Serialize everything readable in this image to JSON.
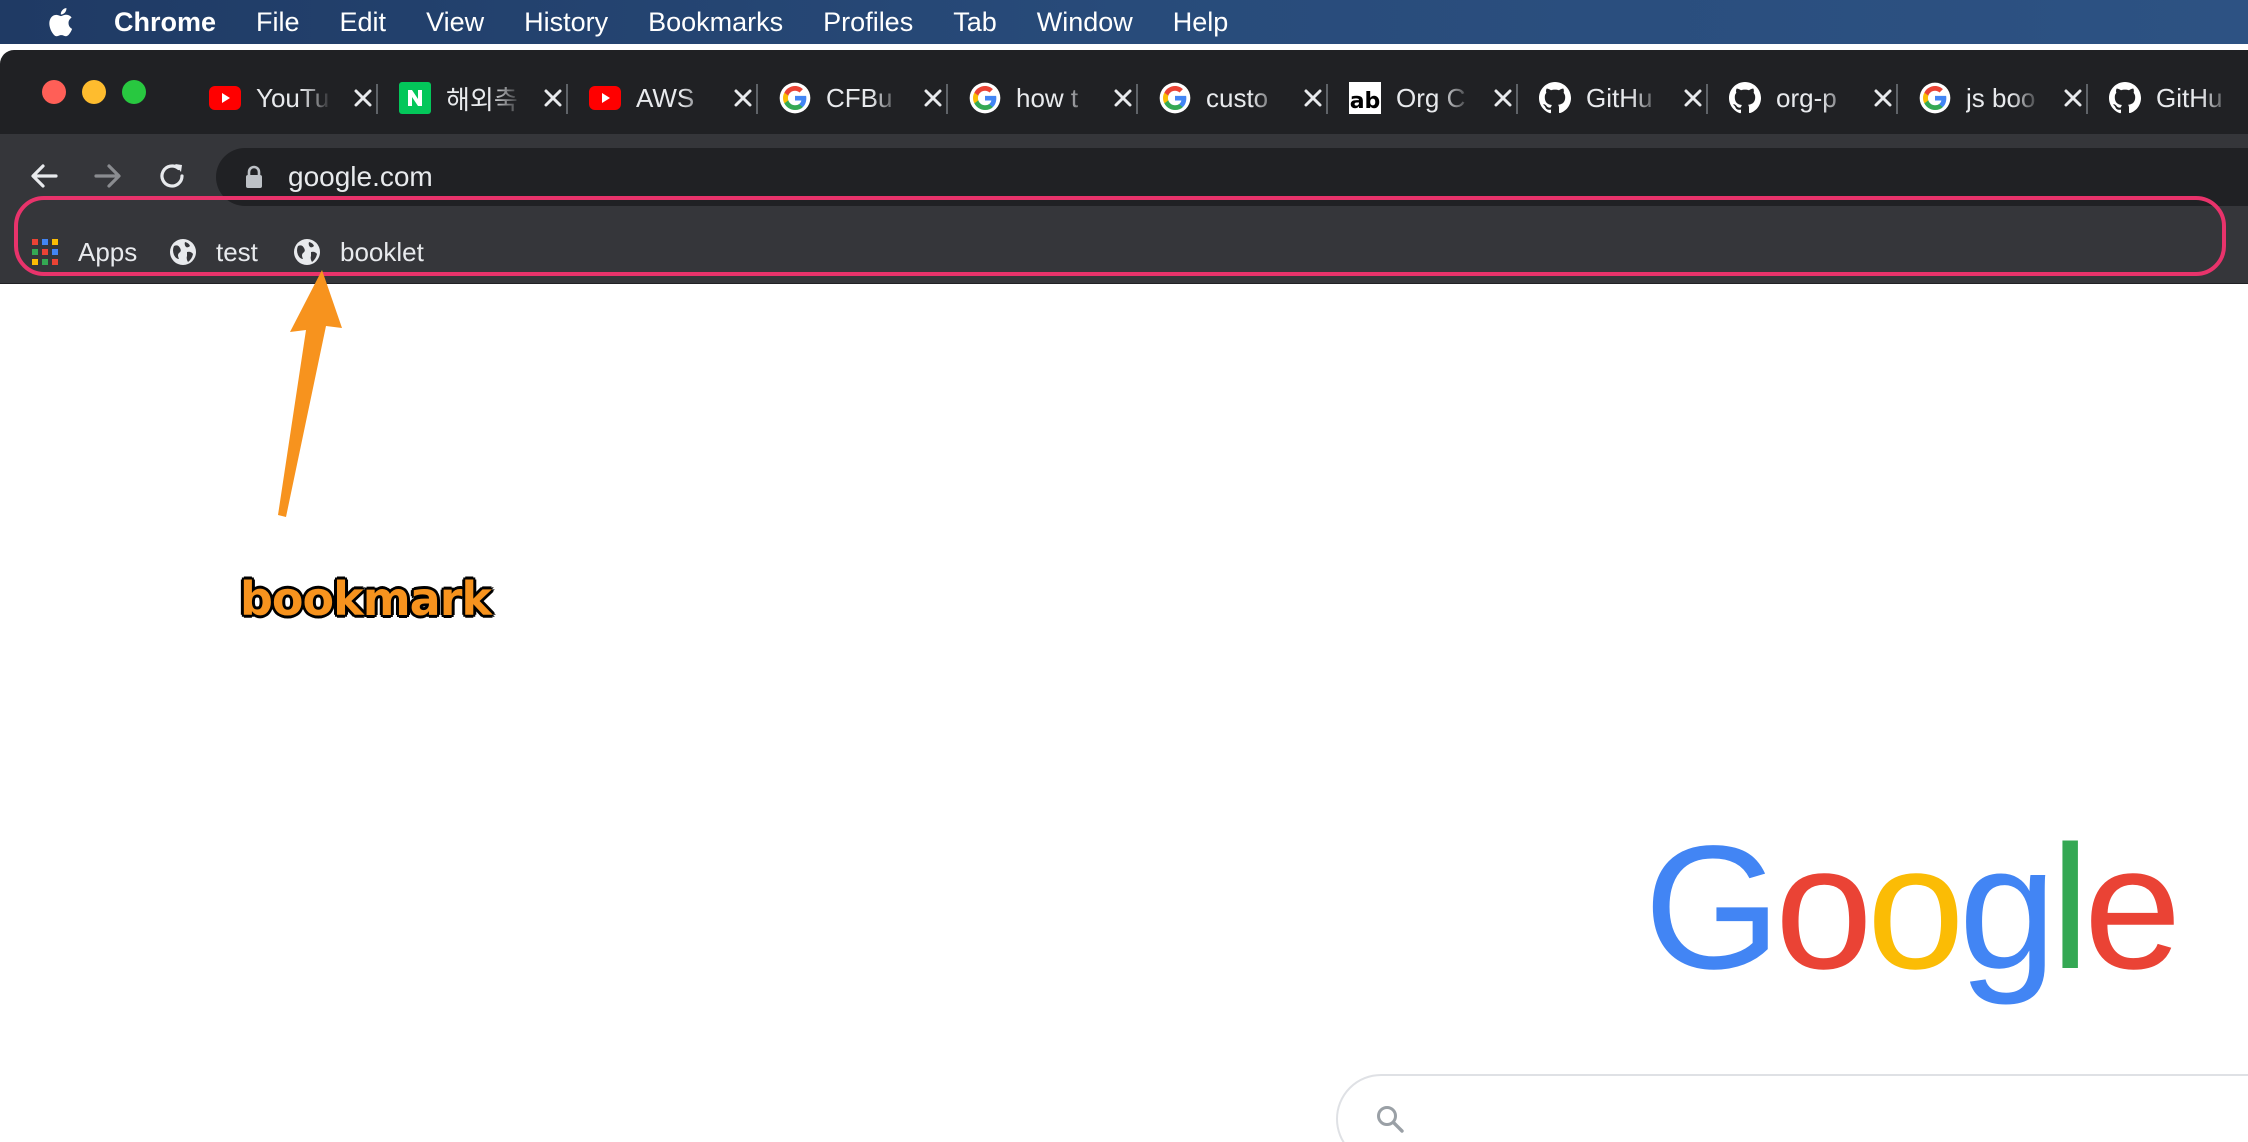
{
  "menubar": {
    "app_name": "Chrome",
    "items": [
      "File",
      "Edit",
      "View",
      "History",
      "Bookmarks",
      "Profiles",
      "Tab",
      "Window",
      "Help"
    ]
  },
  "tabs": [
    {
      "title": "YouTu",
      "icon": "youtube-icon"
    },
    {
      "title": "해외축",
      "icon": "naver-icon"
    },
    {
      "title": "AWS",
      "icon": "youtube-icon"
    },
    {
      "title": "CFBu",
      "icon": "google-icon"
    },
    {
      "title": "how t",
      "icon": "google-icon"
    },
    {
      "title": "custo",
      "icon": "google-icon"
    },
    {
      "title": "Org C",
      "icon": "ab-icon"
    },
    {
      "title": "GitHu",
      "icon": "github-icon"
    },
    {
      "title": "org-p",
      "icon": "github-icon"
    },
    {
      "title": "js boo",
      "icon": "google-icon"
    },
    {
      "title": "GitHu",
      "icon": "github-icon"
    }
  ],
  "toolbar": {
    "url": "google.com"
  },
  "bookmarks": [
    {
      "label": "Apps",
      "icon": "apps-grid-icon"
    },
    {
      "label": "test",
      "icon": "globe-icon"
    },
    {
      "label": "booklet",
      "icon": "globe-icon"
    }
  ],
  "annotation": {
    "label": "bookmark",
    "highlight_color": "#e8336b",
    "arrow_color": "#f7931e"
  },
  "page": {
    "logo": "Google",
    "search_placeholder": ""
  }
}
